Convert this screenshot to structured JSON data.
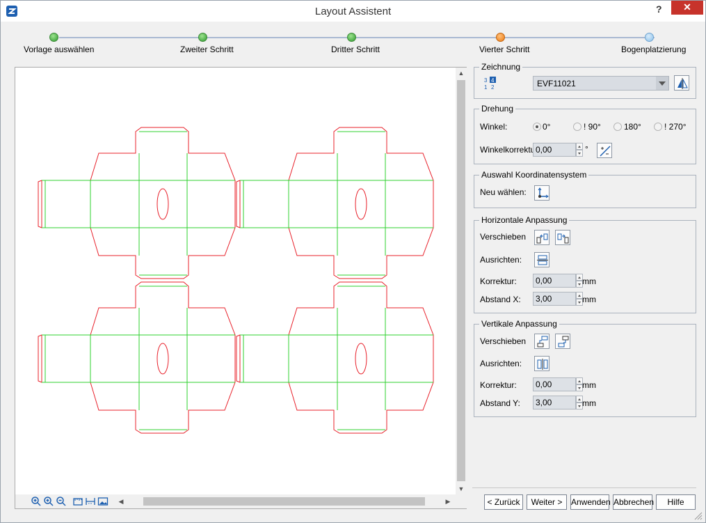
{
  "window": {
    "title": "Layout Assistent",
    "help": "?",
    "close": "✕"
  },
  "steps": [
    {
      "label": "Vorlage auswählen",
      "state": "done"
    },
    {
      "label": "Zweiter Schritt",
      "state": "done"
    },
    {
      "label": "Dritter Schritt",
      "state": "done"
    },
    {
      "label": "Vierter Schritt",
      "state": "current"
    },
    {
      "label": "Bogenplatzierung",
      "state": "pending"
    }
  ],
  "colors": {
    "cut_line": "#e8202a",
    "fold_line": "#2ed02e",
    "accent": "#1d5fb0"
  },
  "toolbar_icons": [
    "zoom-in-icon",
    "zoom-fit-icon",
    "zoom-out-icon",
    "ruler-icon",
    "measure-icon",
    "image-icon"
  ],
  "zeichnung": {
    "label": "Zeichnung",
    "selected": "EVF11021",
    "icon_digits": [
      "3",
      "4",
      "1",
      "2"
    ]
  },
  "drehung": {
    "label": "Drehung",
    "winkel_label": "Winkel:",
    "options": [
      "0°",
      "! 90°",
      "180°",
      "! 270°"
    ],
    "selected": "0°",
    "korrektur_label": "Winkelkorrektu",
    "korrektur_value": "0,00",
    "unit": "°"
  },
  "koordinaten": {
    "label": "Auswahl Koordinatensystem",
    "neu_label": "Neu wählen:"
  },
  "horizontal": {
    "label": "Horizontale Anpassung",
    "verschieben_label": "Verschieben",
    "ausrichten_label": "Ausrichten:",
    "korrektur_label": "Korrektur:",
    "korrektur_value": "0,00",
    "abstand_label": "Abstand X:",
    "abstand_value": "3,00",
    "unit": "mm"
  },
  "vertical": {
    "label": "Vertikale Anpassung",
    "verschieben_label": "Verschieben",
    "ausrichten_label": "Ausrichten:",
    "korrektur_label": "Korrektur:",
    "korrektur_value": "0,00",
    "abstand_label": "Abstand Y:",
    "abstand_value": "3,00",
    "unit": "mm"
  },
  "buttons": {
    "back": "< Zurück",
    "next": "Weiter >",
    "apply": "Anwenden",
    "cancel": "Abbrechen",
    "help": "Hilfe"
  }
}
